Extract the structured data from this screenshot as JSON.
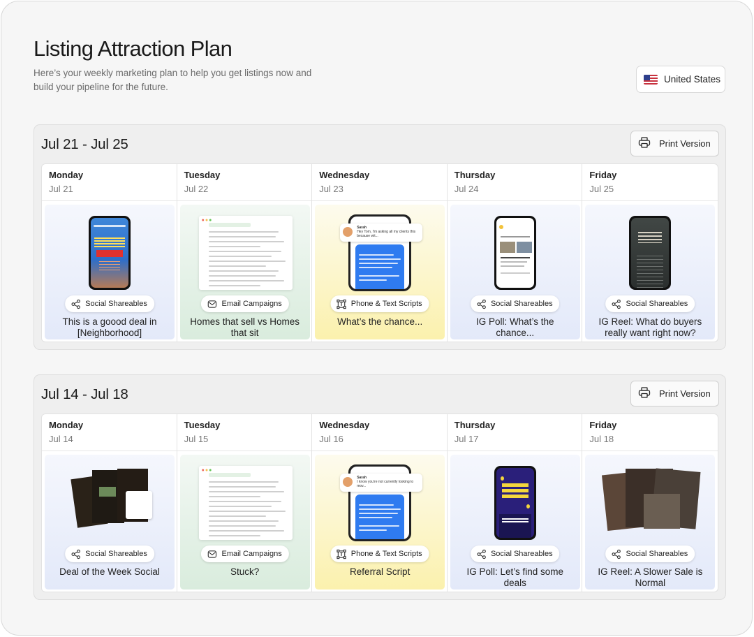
{
  "page": {
    "title": "Listing Attraction Plan",
    "subtitle": "Here’s your weekly marketing plan to help you get listings now and build your pipeline for the future.",
    "country": {
      "label": "United States",
      "icon": "us-flag-icon"
    }
  },
  "weeks": [
    {
      "title": "Jul 21 - Jul 25",
      "print_label": "Print Version",
      "days": [
        {
          "day": "Monday",
          "date": "Jul 21",
          "category": "Social Shareables",
          "icon": "share-icon",
          "text": "This is a goood deal in [Neighborhood]",
          "color": "blue",
          "thumb": "phone-red"
        },
        {
          "day": "Tuesday",
          "date": "Jul 22",
          "category": "Email Campaigns",
          "icon": "mail-icon",
          "text": "Homes that sell vs Homes that sit",
          "color": "green",
          "thumb": "doc"
        },
        {
          "day": "Wednesday",
          "date": "Jul 23",
          "category": "Phone & Text Scripts",
          "icon": "script-icon",
          "text": "What’s the chance...",
          "color": "yellow",
          "thumb": "chat",
          "chat_name": "Sarah",
          "chat_text": "Hey Tom, I'm asking all my clients this because wit..."
        },
        {
          "day": "Thursday",
          "date": "Jul 24",
          "category": "Social Shareables",
          "icon": "share-icon",
          "text": "IG Poll: What’s the chance...",
          "color": "blue",
          "thumb": "phone-white"
        },
        {
          "day": "Friday",
          "date": "Jul 25",
          "category": "Social Shareables",
          "icon": "share-icon",
          "text": "IG Reel: What do buyers really want right now?",
          "color": "blue",
          "thumb": "phone-dark"
        }
      ]
    },
    {
      "title": "Jul 14 - Jul 18",
      "print_label": "Print Version",
      "days": [
        {
          "day": "Monday",
          "date": "Jul 14",
          "category": "Social Shareables",
          "icon": "share-icon",
          "text": "Deal of the Week Social",
          "color": "blue",
          "thumb": "cards"
        },
        {
          "day": "Tuesday",
          "date": "Jul 15",
          "category": "Email Campaigns",
          "icon": "mail-icon",
          "text": "Stuck?",
          "color": "green",
          "thumb": "doc"
        },
        {
          "day": "Wednesday",
          "date": "Jul 16",
          "category": "Phone & Text Scripts",
          "icon": "script-icon",
          "text": "Referral Script",
          "color": "yellow",
          "thumb": "chat",
          "chat_name": "Sarah",
          "chat_text": "I know you're not currently looking to mov..."
        },
        {
          "day": "Thursday",
          "date": "Jul 17",
          "category": "Social Shareables",
          "icon": "share-icon",
          "text": "IG Poll: Let’s find some deals",
          "color": "blue",
          "thumb": "phone-purple"
        },
        {
          "day": "Friday",
          "date": "Jul 18",
          "category": "Social Shareables",
          "icon": "share-icon",
          "text": "IG Reel: A Slower Sale is Normal",
          "color": "blue",
          "thumb": "photos"
        }
      ]
    }
  ]
}
